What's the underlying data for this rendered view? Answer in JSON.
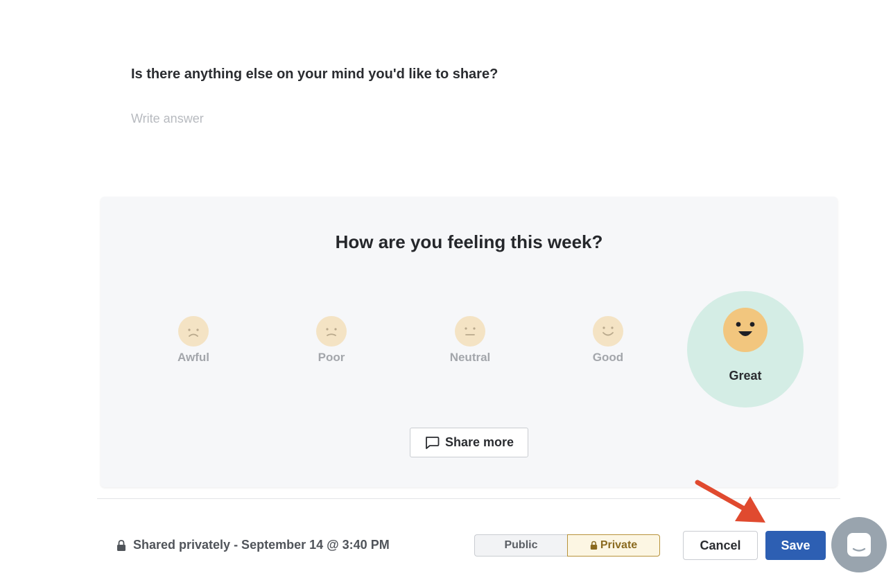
{
  "question": {
    "text": "Is there anything else on your mind you'd like to share?",
    "answer_value": "",
    "answer_placeholder": "Write answer"
  },
  "mood": {
    "title": "How are you feeling this week?",
    "options": [
      {
        "label": "Awful",
        "icon": "awful-face-icon"
      },
      {
        "label": "Poor",
        "icon": "poor-face-icon"
      },
      {
        "label": "Neutral",
        "icon": "neutral-face-icon"
      },
      {
        "label": "Good",
        "icon": "good-face-icon"
      },
      {
        "label": "Great",
        "icon": "great-face-icon",
        "selected": true
      }
    ],
    "share_more_label": "Share more"
  },
  "footer": {
    "status_text": "Shared privately - September 14 @ 3:40 PM",
    "visibility": {
      "public_label": "Public",
      "private_label": "Private",
      "selected": "Private"
    },
    "cancel_label": "Cancel",
    "save_label": "Save"
  },
  "colors": {
    "primary": "#2d5fb3",
    "selected_mood_bg": "#d4ede5",
    "face_selected": "#f2c67e",
    "face_muted": "#f4e3c4",
    "private_accent": "#b7923a",
    "annotation_arrow": "#e04a2f"
  }
}
